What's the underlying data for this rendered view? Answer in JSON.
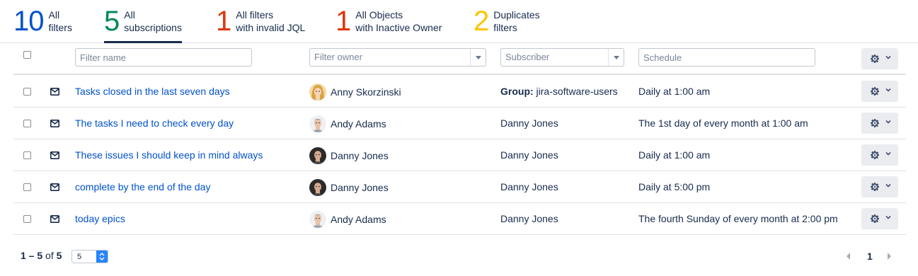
{
  "tabs": [
    {
      "count": "10",
      "line1": "All",
      "line2": "filters",
      "color": "#0052cc",
      "active": false
    },
    {
      "count": "5",
      "line1": "All",
      "line2": "subscriptions",
      "color": "#00875a",
      "active": true
    },
    {
      "count": "1",
      "line1": "All filters",
      "line2": "with invalid JQL",
      "color": "#de350b",
      "active": false
    },
    {
      "count": "1",
      "line1": "All Objects",
      "line2": "with Inactive Owner",
      "color": "#de350b",
      "active": false
    },
    {
      "count": "2",
      "line1": "Duplicates",
      "line2": "filters",
      "color": "#ffc400",
      "active": false
    }
  ],
  "filters": {
    "filter_name_placeholder": "Filter name",
    "filter_owner_placeholder": "Filter owner",
    "subscriber_placeholder": "Subscriber",
    "schedule_placeholder": "Schedule"
  },
  "rows": [
    {
      "name": "Tasks closed in the last seven days",
      "owner": "Anny Skorzinski",
      "avatar": "female-avatar",
      "subscriber_prefix": "Group:",
      "subscriber": " jira-software-users",
      "schedule": "Daily at 1:00 am"
    },
    {
      "name": "The tasks I need to check every day",
      "owner": "Andy Adams",
      "avatar": "male-avatar-light",
      "subscriber_prefix": "",
      "subscriber": "Danny Jones",
      "schedule": "The 1st day of every month at 1:00 am"
    },
    {
      "name": "These issues I should keep in mind always",
      "owner": "Danny Jones",
      "avatar": "male-avatar-dark",
      "subscriber_prefix": "",
      "subscriber": "Danny Jones",
      "schedule": "Daily at 1:00 am"
    },
    {
      "name": "complete by the end of the day",
      "owner": "Danny Jones",
      "avatar": "male-avatar-dark",
      "subscriber_prefix": "",
      "subscriber": "Danny Jones",
      "schedule": "Daily at 5:00 pm"
    },
    {
      "name": "today epics",
      "owner": "Andy Adams",
      "avatar": "male-avatar-light",
      "subscriber_prefix": "",
      "subscriber": "Danny Jones",
      "schedule": "The fourth Sunday of every month at 2:00 pm"
    }
  ],
  "footer": {
    "range": "1 – 5",
    "of_label": "of",
    "total": "5",
    "page_size": "5",
    "current_page": "1"
  },
  "icons": {
    "gear": "gear-icon",
    "chevron": "chevron-down-icon",
    "mail": "envelope-icon",
    "prev": "chevron-left-icon",
    "next": "chevron-right-icon"
  }
}
